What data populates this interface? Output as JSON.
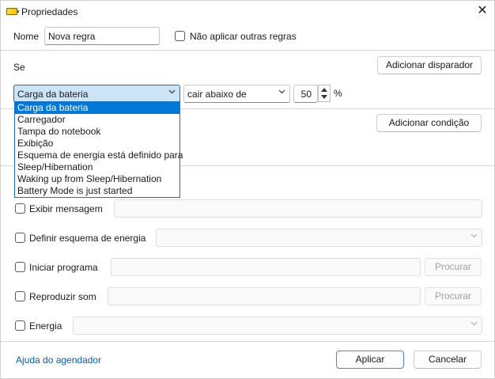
{
  "window": {
    "title": "Propriedades",
    "title_icon": "battery-icon",
    "close_symbol": "✕"
  },
  "name_row": {
    "label": "Nome",
    "value": "Nova regra",
    "no_other_rules_label": "Não aplicar outras regras",
    "no_other_rules_checked": false
  },
  "trigger": {
    "label": "Se",
    "add_trigger_button": "Adicionar disparador",
    "source_selected": "Carga da bateria",
    "condition_selected": "cair abaixo de",
    "threshold_value": "50",
    "unit": "%",
    "dropdown_options": [
      "Carga da bateria",
      "Carregador",
      "Tampa do notebook",
      "Exibição",
      "Esquema de energia está definido para",
      "Sleep/Hibernation",
      "Waking up from Sleep/Hibernation",
      "Battery Mode is just started"
    ],
    "dropdown_selected_index": 0
  },
  "condition": {
    "add_condition_button": "Adicionar condição"
  },
  "actions": {
    "show_message": {
      "label": "Exibir mensagem",
      "checked": false,
      "value": ""
    },
    "set_power_scheme": {
      "label": "Definir esquema de energia",
      "checked": false,
      "value": ""
    },
    "start_program": {
      "label": "Iniciar programa",
      "checked": false,
      "value": "",
      "browse_button": "Procurar"
    },
    "play_sound": {
      "label": "Reproduzir som",
      "checked": false,
      "value": "",
      "browse_button": "Procurar"
    },
    "energy": {
      "label": "Energia",
      "checked": false,
      "value": ""
    }
  },
  "footer": {
    "help_link": "Ajuda do agendador",
    "apply_button": "Aplicar",
    "cancel_button": "Cancelar"
  },
  "colors": {
    "accent": "#0078d7",
    "focus_fill": "#cce4f7",
    "link": "#0b5cad"
  }
}
